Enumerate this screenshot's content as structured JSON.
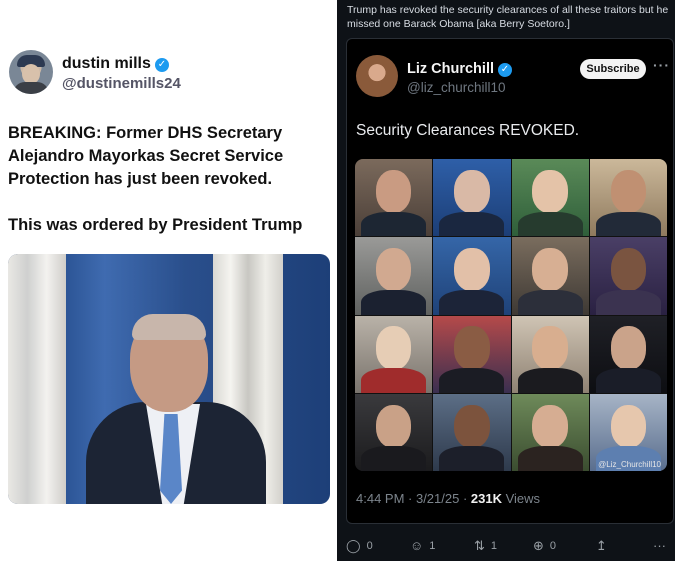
{
  "left": {
    "author_name": "dustin mills",
    "author_handle": "@dustinemills24",
    "tweet_line1": "BREAKING: Former DHS Secretary Alejandro Mayorkas Secret Service Protection has just been revoked.",
    "tweet_line2": "This was ordered by President Trump"
  },
  "right": {
    "quote_text": "Trump has revoked the security clearances of all these traitors but he missed one Barack Obama [aka Berry Soetoro.]",
    "card": {
      "author_name": "Liz Churchill",
      "author_handle": "@liz_churchill10",
      "subscribe_label": "Subscribe",
      "more_label": "···",
      "text": "Security Clearances REVOKED.",
      "watermark": "@Liz_Churchill10",
      "time": "4:44 PM · 3/21/25 · ",
      "views_count": "231K",
      "views_label": " Views"
    },
    "actions": {
      "reply_count": "0",
      "like_count": "1",
      "repost_count": "1",
      "view_count": "0"
    },
    "icons": [
      "reply-icon",
      "like-icon",
      "repost-icon",
      "views-icon",
      "share-icon",
      "more-icon"
    ]
  },
  "colors": {
    "verified": "#1d9bf0",
    "dark_bg": "#0e1217"
  }
}
